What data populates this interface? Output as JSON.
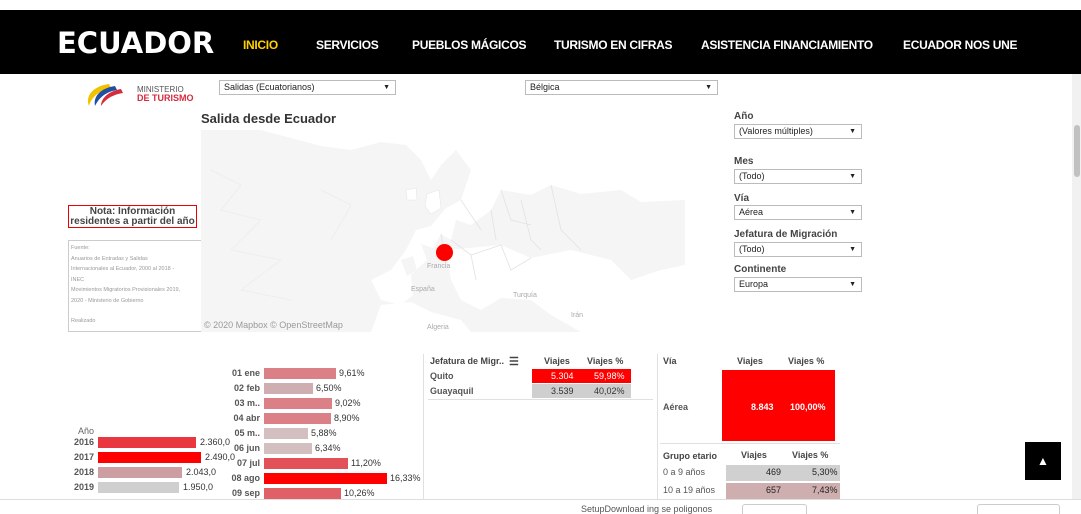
{
  "nav": {
    "logo": "ECUADOR",
    "items": [
      "INICIO",
      "SERVICIOS",
      "PUEBLOS MÁGICOS",
      "TURISMO EN CIFRAS",
      "ASISTENCIA FINANCIAMIENTO",
      "ECUADOR NOS UNE"
    ],
    "active": "INICIO",
    "active_color": "#ffd000"
  },
  "ministry": {
    "line1": "MINISTERIO",
    "line2": "DE TURISMO"
  },
  "top_filters": {
    "type": "Salidas (Ecuatorianos)",
    "country": "Bélgica"
  },
  "map": {
    "title": "Salida desde Ecuador",
    "credit": "© 2020 Mapbox © OpenStreetMap",
    "labels": {
      "francia": "Francia",
      "espana": "España",
      "turquia": "Turquía",
      "iran": "Irán",
      "algeria": "Algeria"
    },
    "marker_color": "#ff0000"
  },
  "nota": "Nota: Información residentes a partir del año",
  "fuente": {
    "lines": [
      "Fuente:",
      "Anuarios de Entradas y Salidas",
      "Internacionales al Ecuador, 2000 al 2018 -",
      "INEC",
      "Movimientos Migratorios Provisionales 2019,",
      "2020 - Ministerio de Gobierno",
      "",
      "Realizado"
    ]
  },
  "filters": {
    "anio": {
      "label": "Año",
      "value": "(Valores múltiples)"
    },
    "mes": {
      "label": "Mes",
      "value": "(Todo)"
    },
    "via": {
      "label": "Vía",
      "value": "Aérea"
    },
    "jefatura": {
      "label": "Jefatura de Migración",
      "value": "(Todo)"
    },
    "continente": {
      "label": "Continente",
      "value": "Europa"
    }
  },
  "years": {
    "label": "Año",
    "rows": [
      {
        "year": "2016",
        "value": "2.360,0",
        "pct": 0.948,
        "color": "#e8373f"
      },
      {
        "year": "2017",
        "value": "2.490,0",
        "pct": 1.0,
        "color": "#ff0000"
      },
      {
        "year": "2018",
        "value": "2.043,0",
        "pct": 0.82,
        "color": "#cc9ea2"
      },
      {
        "year": "2019",
        "value": "1.950,0",
        "pct": 0.783,
        "color": "#cfcfcf"
      }
    ]
  },
  "months": [
    {
      "label": "01 ene",
      "value": "9,61%",
      "pct": 0.588,
      "color": "#dc8087"
    },
    {
      "label": "02 feb",
      "value": "6,50%",
      "pct": 0.398,
      "color": "#cfaeb2"
    },
    {
      "label": "03 m..",
      "value": "9,02%",
      "pct": 0.552,
      "color": "#dc8087"
    },
    {
      "label": "04 abr",
      "value": "8,90%",
      "pct": 0.545,
      "color": "#dc8087"
    },
    {
      "label": "05 m..",
      "value": "5,88%",
      "pct": 0.36,
      "color": "#d3bec0"
    },
    {
      "label": "06 jun",
      "value": "6,34%",
      "pct": 0.388,
      "color": "#d3bec0"
    },
    {
      "label": "07 jul",
      "value": "11,20%",
      "pct": 0.686,
      "color": "#e25058"
    },
    {
      "label": "08 ago",
      "value": "16,33%",
      "pct": 1.0,
      "color": "#ff0000"
    },
    {
      "label": "09 sep",
      "value": "10,26%",
      "pct": 0.628,
      "color": "#e06068"
    }
  ],
  "jefatura": {
    "headers": [
      "Jefatura de Migr..",
      "Viajes",
      "Viajes %"
    ],
    "rows": [
      {
        "name": "Quito",
        "viajes": "5.304",
        "pct": "59,98%",
        "color": "#ff0000",
        "text": "#ffffff"
      },
      {
        "name": "Guayaquil",
        "viajes": "3.539",
        "pct": "40,02%",
        "color": "#cfcfcf",
        "text": "#333333"
      }
    ]
  },
  "via_table": {
    "headers": [
      "Vía",
      "Viajes",
      "Viajes %"
    ],
    "row": {
      "name": "Aérea",
      "viajes": "8.843",
      "pct": "100,00%",
      "color": "#ff0000"
    }
  },
  "grupo": {
    "headers": [
      "Grupo etario",
      "Viajes",
      "Viajes %"
    ],
    "rows": [
      {
        "name": "0 a 9 años",
        "viajes": "469",
        "pct": "5,30%",
        "color": "#d0d0d0"
      },
      {
        "name": "10 a 19 años",
        "viajes": "657",
        "pct": "7,43%",
        "color": "#cfaeb0"
      }
    ]
  },
  "footer": {
    "text": "SetupDownload ing se poligonos"
  }
}
